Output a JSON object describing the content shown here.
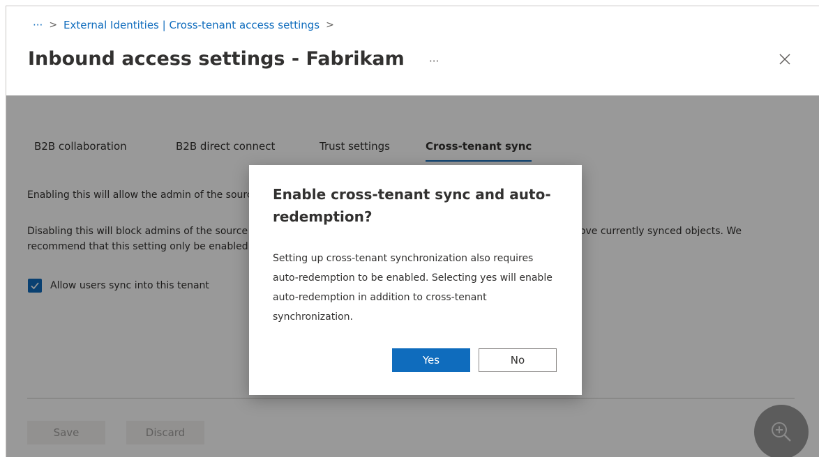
{
  "breadcrumb": {
    "more": "···",
    "items": [
      "External Identities | Cross-tenant access settings"
    ]
  },
  "header": {
    "title": "Inbound access settings - Fabrikam",
    "more": "···"
  },
  "tabs": [
    {
      "label": "B2B collaboration",
      "active": false
    },
    {
      "label": "B2B direct connect",
      "active": false
    },
    {
      "label": "Trust settings",
      "active": false
    },
    {
      "label": "Cross-tenant sync",
      "active": true
    }
  ],
  "main": {
    "para1": "Enabling this will allow the admin of the source tenant to sync user objects into the target tenant.",
    "para2": "Disabling this will block admins of the source tenant from syncing objects into the target tenant, but will not remove currently synced objects. We recommend that this setting only be enabled with tenants in the same organization.",
    "checkbox_label": "Allow users sync into this tenant",
    "checkbox_checked": true
  },
  "footer": {
    "save_label": "Save",
    "discard_label": "Discard"
  },
  "dialog": {
    "title": "Enable cross-tenant sync and auto-redemption?",
    "body": "Setting up cross-tenant synchronization also requires auto-redemption to be enabled. Selecting yes will enable auto-redemption in addition to cross-tenant synchronization.",
    "yes_label": "Yes",
    "no_label": "No"
  },
  "colors": {
    "accent": "#0f6cbd",
    "overlay": "rgba(0,0,0,0.4)"
  },
  "icons": {
    "close": "close-icon",
    "check": "checkmark-icon",
    "zoom": "zoom-in-icon"
  }
}
